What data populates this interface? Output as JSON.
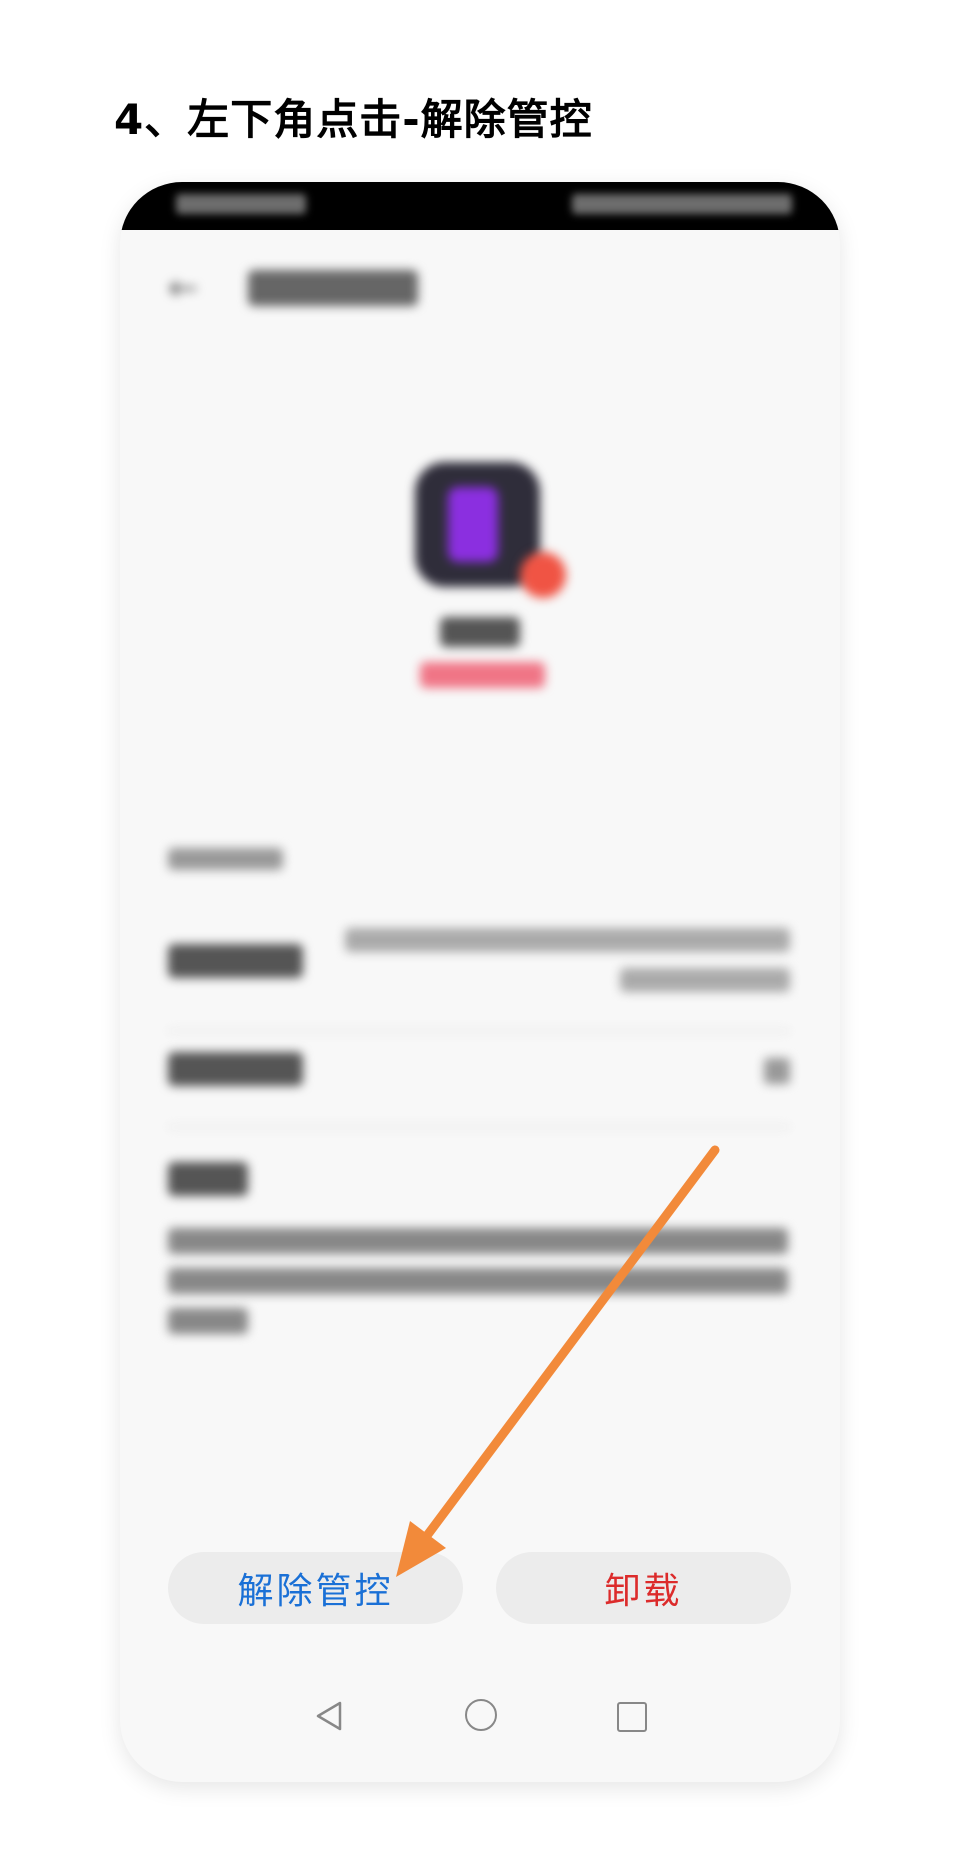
{
  "step_title": "4、左下角点击-解除管控",
  "buttons": {
    "release_control": "解除管控",
    "uninstall": "卸载"
  },
  "colors": {
    "arrow": "#f28a3a",
    "release_button_text": "#1a70d6",
    "uninstall_button_text": "#dc2b2b",
    "app_icon_bg": "#2f2d3a",
    "app_icon_accent": "#8b2fe0",
    "risk_badge": "#f05444"
  },
  "icons": {
    "back": "arrow-left-icon",
    "app": "app-icon",
    "badge": "risk-badge-icon",
    "chevron": "chevron-right-icon",
    "nav_back": "triangle-back-icon",
    "nav_home": "circle-home-icon",
    "nav_recent": "square-recent-icon",
    "annotation": "orange-arrow-pointer"
  }
}
